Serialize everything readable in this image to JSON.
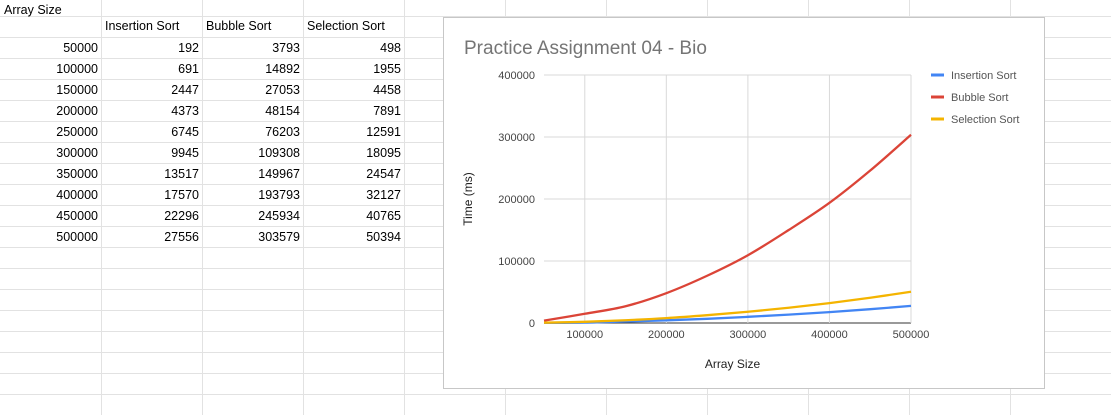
{
  "sheet": {
    "col_a_header": "Array Size",
    "headers": [
      "Insertion Sort",
      "Bubble Sort",
      "Selection Sort"
    ],
    "rows": [
      [
        "50000",
        "192",
        "3793",
        "498"
      ],
      [
        "100000",
        "691",
        "14892",
        "1955"
      ],
      [
        "150000",
        "2447",
        "27053",
        "4458"
      ],
      [
        "200000",
        "4373",
        "48154",
        "7891"
      ],
      [
        "250000",
        "6745",
        "76203",
        "12591"
      ],
      [
        "300000",
        "9945",
        "109308",
        "18095"
      ],
      [
        "350000",
        "13517",
        "149967",
        "24547"
      ],
      [
        "400000",
        "17570",
        "193793",
        "32127"
      ],
      [
        "450000",
        "22296",
        "245934",
        "40765"
      ],
      [
        "500000",
        "27556",
        "303579",
        "50394"
      ]
    ]
  },
  "chart_data": {
    "type": "line",
    "title": "Practice Assignment 04 - Bio",
    "xlabel": "Array Size",
    "ylabel": "Time (ms)",
    "x": [
      50000,
      100000,
      150000,
      200000,
      250000,
      300000,
      350000,
      400000,
      450000,
      500000
    ],
    "xlim": [
      50000,
      500000
    ],
    "ylim": [
      0,
      400000
    ],
    "xticks": [
      "100000",
      "200000",
      "300000",
      "400000",
      "500000"
    ],
    "yticks": [
      "0",
      "100000",
      "200000",
      "300000",
      "400000"
    ],
    "grid": true,
    "legend_position": "right",
    "series": [
      {
        "name": "Insertion Sort",
        "color": "#4285f4",
        "values": [
          192,
          691,
          2447,
          4373,
          6745,
          9945,
          13517,
          17570,
          22296,
          27556
        ]
      },
      {
        "name": "Bubble Sort",
        "color": "#db4437",
        "values": [
          3793,
          14892,
          27053,
          48154,
          76203,
          109308,
          149967,
          193793,
          245934,
          303579
        ]
      },
      {
        "name": "Selection Sort",
        "color": "#f4b400",
        "values": [
          498,
          1955,
          4458,
          7891,
          12591,
          18095,
          24547,
          32127,
          40765,
          50394
        ]
      }
    ]
  }
}
